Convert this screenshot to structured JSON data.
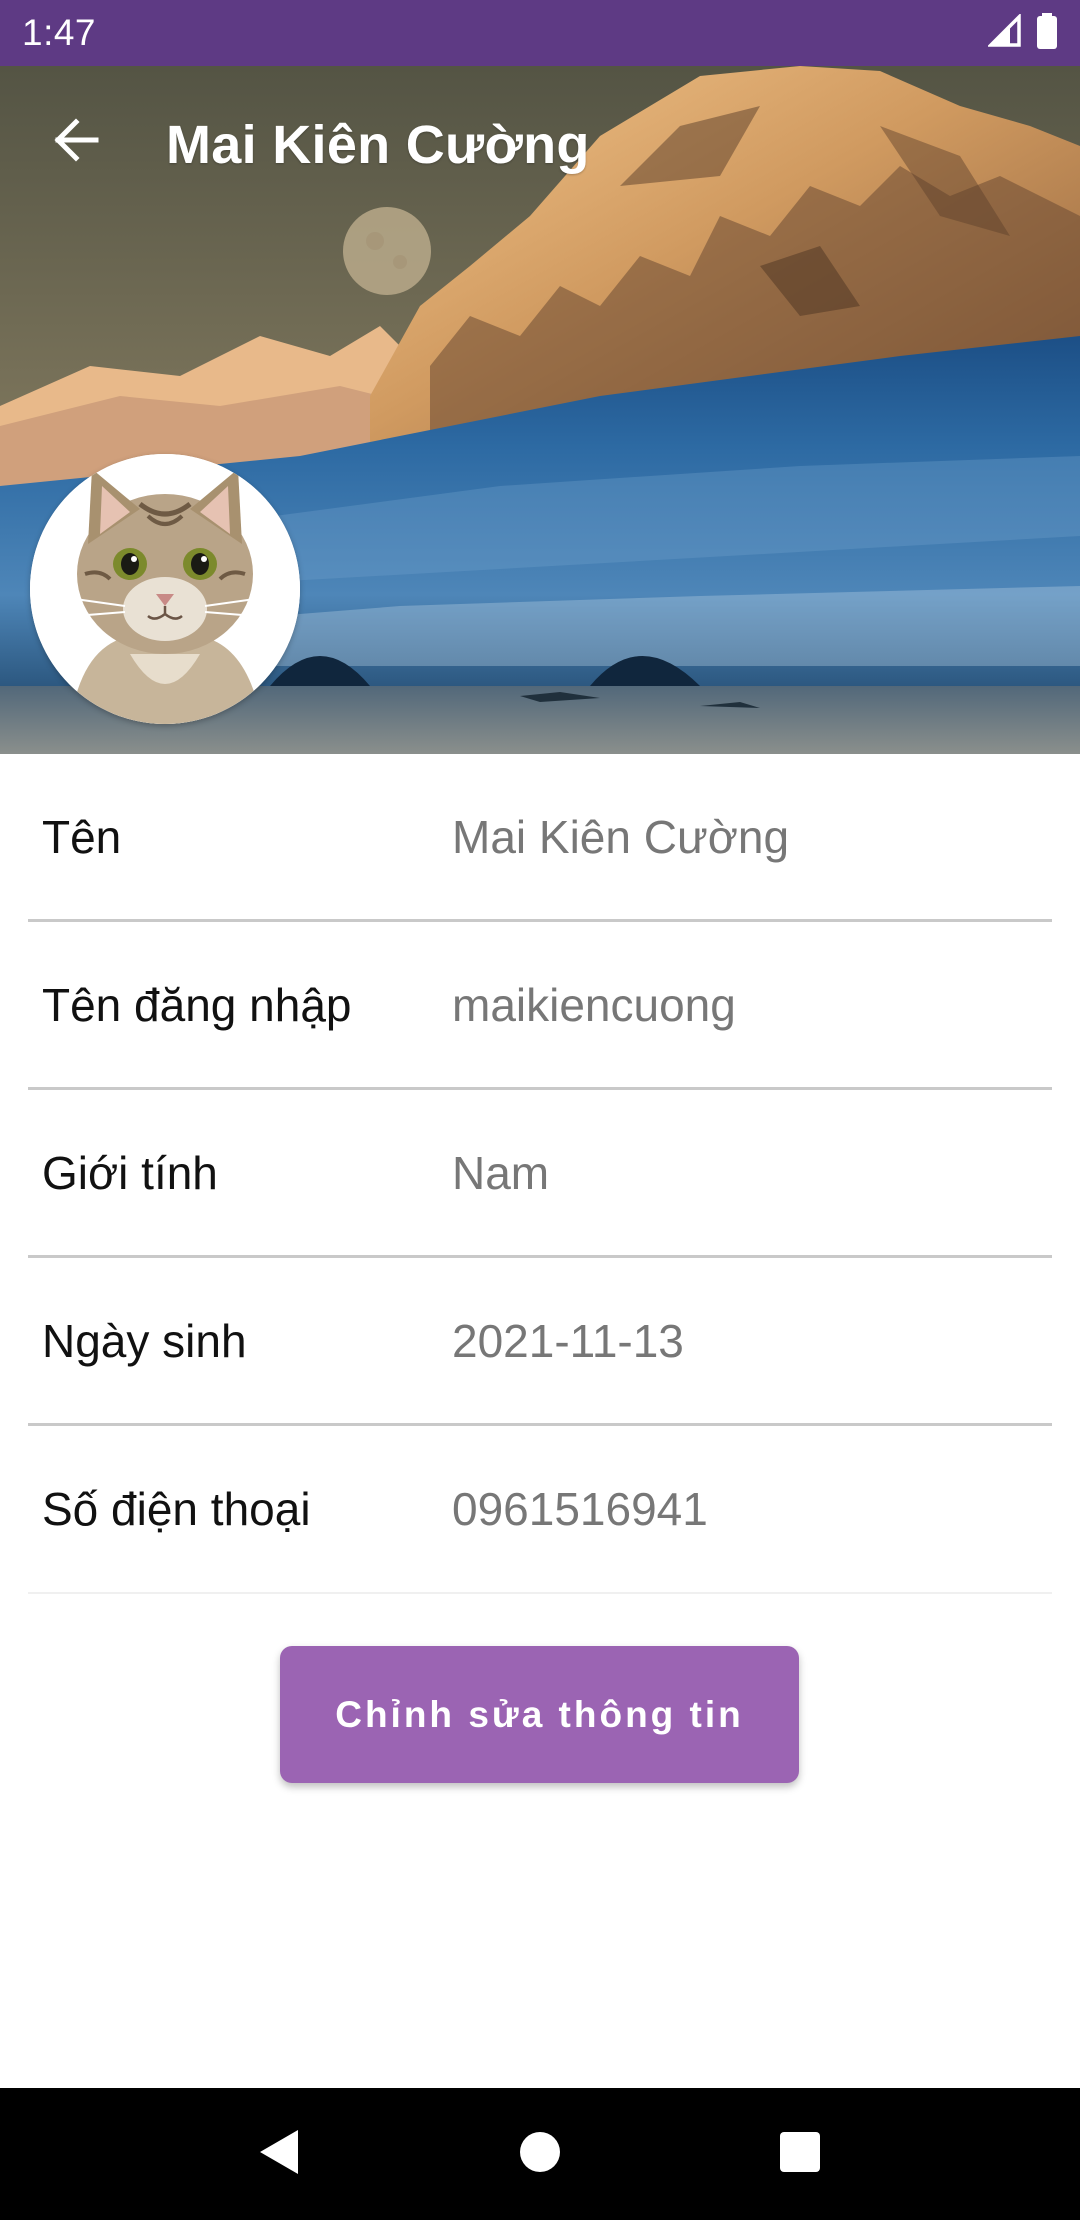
{
  "status_bar": {
    "time": "1:47",
    "icons": [
      "cell-signal-icon",
      "battery-icon"
    ]
  },
  "toolbar": {
    "title": "Mai Kiên Cường",
    "back_icon": "arrow-left-icon"
  },
  "profile": {
    "rows": [
      {
        "label": "Tên",
        "value": "Mai Kiên Cường"
      },
      {
        "label": "Tên đăng nhập",
        "value": "maikiencuong"
      },
      {
        "label": "Giới tính",
        "value": "Nam"
      },
      {
        "label": "Ngày sinh",
        "value": "2021-11-13"
      },
      {
        "label": "Số điện thoại",
        "value": "0961516941"
      }
    ]
  },
  "actions": {
    "edit_label": "Chỉnh sửa thông tin"
  },
  "nav_bar": {
    "icons": [
      "back-triangle-icon",
      "home-circle-icon",
      "recents-square-icon"
    ]
  },
  "colors": {
    "status_bar": "#5e3a84",
    "button": "#9b64b3",
    "label": "#111111",
    "value": "#777777",
    "divider": "#c9c9c9"
  }
}
